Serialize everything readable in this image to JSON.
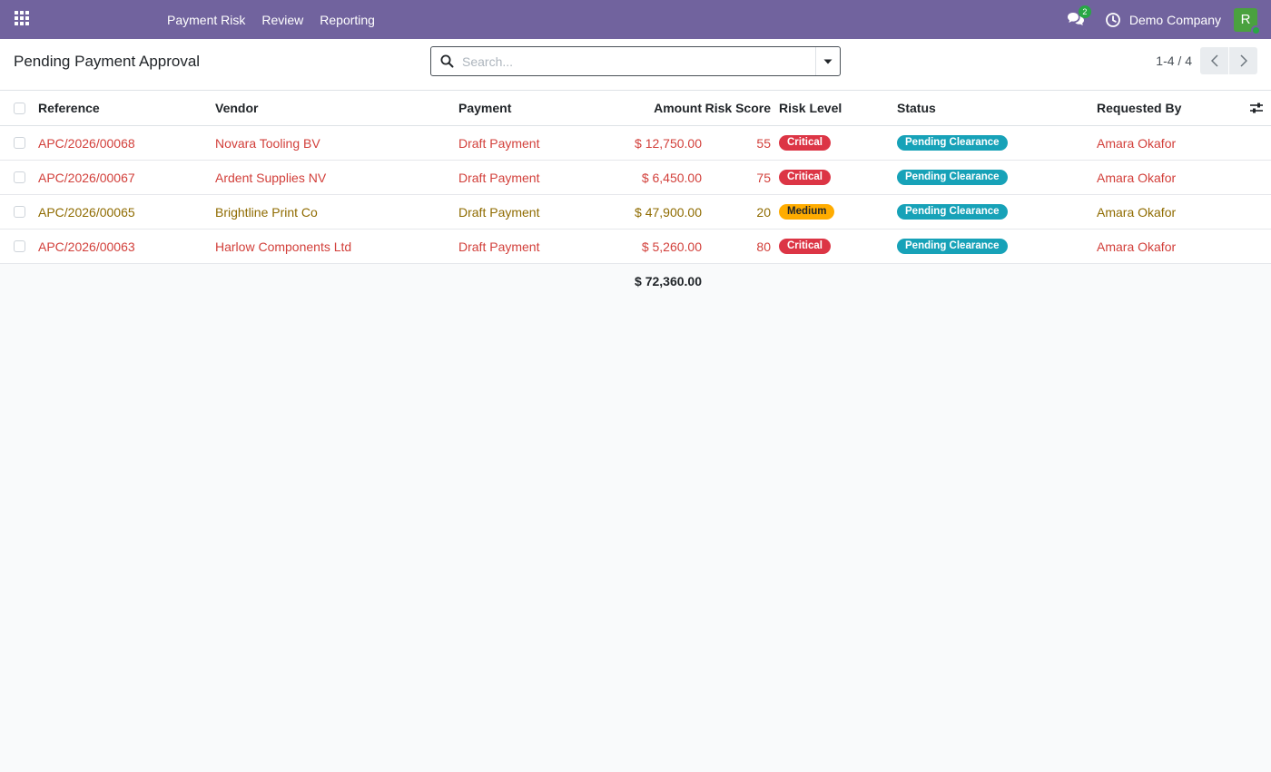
{
  "navbar": {
    "menu": [
      "Payment Risk",
      "Review",
      "Reporting"
    ],
    "chat_count": "2",
    "company": "Demo Company",
    "avatar_initial": "R",
    "icons": [
      "apps-grid-icon",
      "chat-icon",
      "clock-icon"
    ],
    "bg_color": "#71639e"
  },
  "control_panel": {
    "title": "Pending Payment Approval",
    "search_placeholder": "Search...",
    "pager": "1-4 / 4"
  },
  "table": {
    "columns": [
      "Reference",
      "Vendor",
      "Payment",
      "Amount",
      "Risk Score",
      "Risk Level",
      "Status",
      "Requested By"
    ],
    "rows": [
      {
        "reference": "APC/2026/00068",
        "vendor": "Novara Tooling BV",
        "payment": "Draft Payment",
        "amount": "$ 12,750.00",
        "risk_score": "55",
        "risk_level": "Critical",
        "status": "Pending Clearance",
        "requested_by": "Amara Okafor",
        "tone": "red"
      },
      {
        "reference": "APC/2026/00067",
        "vendor": "Ardent Supplies NV",
        "payment": "Draft Payment",
        "amount": "$ 6,450.00",
        "risk_score": "75",
        "risk_level": "Critical",
        "status": "Pending Clearance",
        "requested_by": "Amara Okafor",
        "tone": "red"
      },
      {
        "reference": "APC/2026/00065",
        "vendor": "Brightline Print Co",
        "payment": "Draft Payment",
        "amount": "$ 47,900.00",
        "risk_score": "20",
        "risk_level": "Medium",
        "status": "Pending Clearance",
        "requested_by": "Amara Okafor",
        "tone": "gold"
      },
      {
        "reference": "APC/2026/00063",
        "vendor": "Harlow Components Ltd",
        "payment": "Draft Payment",
        "amount": "$ 5,260.00",
        "risk_score": "80",
        "risk_level": "Critical",
        "status": "Pending Clearance",
        "requested_by": "Amara Okafor",
        "tone": "red"
      }
    ],
    "total_amount": "$ 72,360.00"
  },
  "colors": {
    "critical": "#dc3545",
    "medium": "#ffac00",
    "status": "#17a2b8",
    "link_red": "#d23f3a",
    "link_gold": "#8f6b00"
  }
}
